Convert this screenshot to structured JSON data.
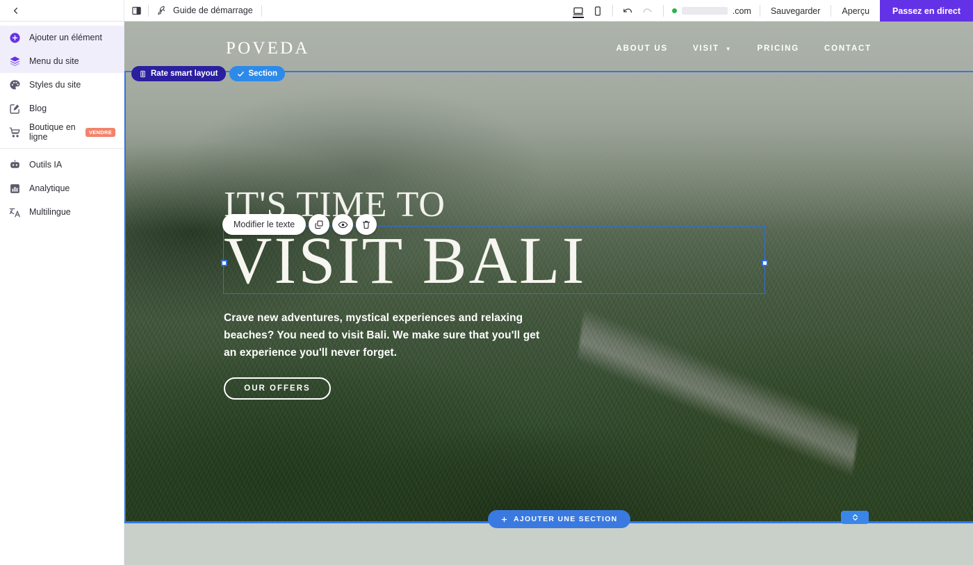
{
  "topbar": {
    "back_icon": "chevron-left-icon",
    "panel_toggle_icon": "sidebar-panel-icon",
    "guide_icon": "rocket-icon",
    "guide_label": "Guide de démarrage",
    "desktop_icon": "desktop-icon",
    "mobile_icon": "mobile-icon",
    "undo_icon": "undo-icon",
    "redo_icon": "redo-icon",
    "status_dot_color": "#2eb14f",
    "domain_suffix": ".com",
    "domain_redacted": true,
    "save_label": "Sauvegarder",
    "preview_label": "Aperçu",
    "publish_label": "Passez en direct",
    "publish_color": "#6432e6"
  },
  "sidebar": {
    "items": [
      {
        "label": "Ajouter un élément",
        "icon": "plus-circle-icon",
        "active": true,
        "badge": null
      },
      {
        "label": "Menu du site",
        "icon": "layers-icon",
        "active": true,
        "badge": null
      },
      {
        "label": "Styles du site",
        "icon": "palette-icon",
        "active": false,
        "badge": null
      },
      {
        "label": "Blog",
        "icon": "pencil-square-icon",
        "active": false,
        "badge": null
      },
      {
        "label": "Boutique en ligne",
        "icon": "cart-icon",
        "active": false,
        "badge": "VENDRE"
      }
    ],
    "items2": [
      {
        "label": "Outils IA",
        "icon": "robot-icon",
        "active": false,
        "badge": null
      },
      {
        "label": "Analytique",
        "icon": "bar-chart-icon",
        "active": false,
        "badge": null
      },
      {
        "label": "Multilingue",
        "icon": "translate-icon",
        "active": false,
        "badge": null
      }
    ],
    "badge_color": "#f2836b"
  },
  "canvas": {
    "badges": [
      {
        "label": "Rate smart layout",
        "icon": "smart-layout-icon",
        "color": "#2a1f9e"
      },
      {
        "label": "Section",
        "icon": "check-icon",
        "color": "#2e8ae8"
      }
    ],
    "element_toolbar": {
      "edit_label": "Modifier le texte",
      "duplicate_icon": "duplicate-icon",
      "hide_icon": "eye-icon",
      "delete_icon": "trash-icon"
    },
    "add_section": {
      "label": "AJOUTER UNE SECTION",
      "icon": "plus-icon",
      "color": "#3a7ae0"
    },
    "resize_handle_icon": "chevron-up-down-icon",
    "selection_color": "#2e6ee0",
    "section_outline_color": "#2e78e8",
    "background_color": "#c9cfc9"
  },
  "site": {
    "logo": "POVEDA",
    "nav": [
      {
        "label": "ABOUT US",
        "caret": false
      },
      {
        "label": "VISIT",
        "caret": true
      },
      {
        "label": "PRICING",
        "caret": false
      },
      {
        "label": "CONTACT",
        "caret": false
      }
    ],
    "hero": {
      "line1": "IT'S TIME TO",
      "line2": "VISIT BALI",
      "paragraph": "Crave new adventures, mystical experiences and relaxing beaches? You need to visit Bali. We make sure that you'll get an experience you'll never forget.",
      "button": "OUR OFFERS"
    }
  }
}
